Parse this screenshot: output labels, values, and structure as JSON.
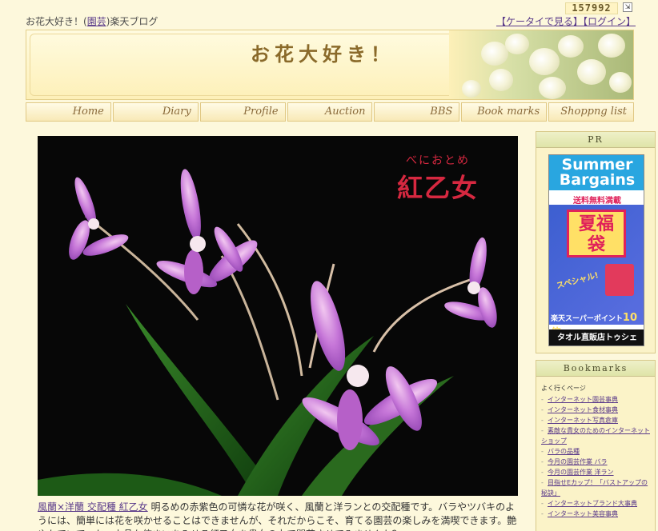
{
  "header": {
    "blog_name": "お花大好き！",
    "category_open": "(",
    "category": "園芸",
    "category_close": ")",
    "service": "楽天ブログ",
    "counter": "157992",
    "mobile_link": "【ケータイで見る】",
    "login_link": "【ログイン】"
  },
  "banner": {
    "title": "お花大好き！"
  },
  "nav": [
    {
      "label": "Home"
    },
    {
      "label": "Diary"
    },
    {
      "label": "Profile"
    },
    {
      "label": "Auction"
    },
    {
      "label": "BBS"
    },
    {
      "label": "Book marks"
    },
    {
      "label": "Shoppng list"
    }
  ],
  "photo": {
    "ruby": "べにおとめ",
    "title": "紅乙女"
  },
  "caption": {
    "link": "風蘭×洋蘭 交配種 紅乙女",
    "text": " 明るめの赤紫色の可憐な花が咲く、風蘭と洋ランとの交配種です。バラやツバキのようには、簡単には花を咲かせることはできませんが、それだからこそ、育てる園芸の楽しみを満喫できます。艶やかでいて、かつ上品な佇まいをみせる紅乙女を貴女の力で開花させてみませんか？"
  },
  "sidebar": {
    "pr_title": "PR",
    "ad": {
      "line1": "Summer",
      "line2": "Bargains",
      "sub": "送料無料満載",
      "big1": "夏福",
      "big2": "袋",
      "special": "スペシャル!",
      "points_text": "楽天スーパーポイント",
      "points_value": "10倍",
      "shop": "タオル直販店トゥシェ"
    },
    "bookmarks_title": "Bookmarks",
    "bookmarks_category": "よく行くページ",
    "bookmarks": [
      "インターネット園芸事典",
      "インターネット食材事典",
      "インターネット写真倉庫",
      "素敵な貴女のためのインターネットショップ",
      "バラの品種",
      "今月の園芸作業 バラ",
      "今月の園芸作業 洋ラン",
      "目指せEカップ！「バストアップの秘訣」",
      "インターネットブランド大事典",
      "インターネット美容事典"
    ]
  }
}
